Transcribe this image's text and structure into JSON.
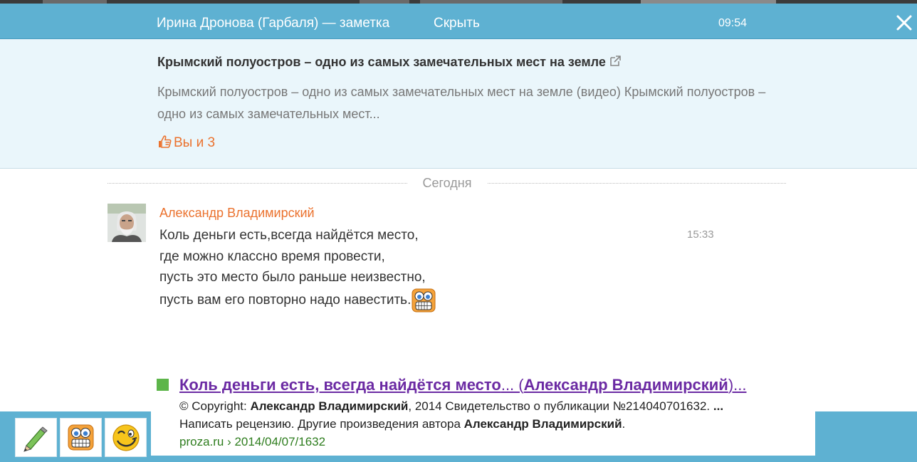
{
  "header": {
    "title": "Ирина Дронова (Гарбаля) — заметка",
    "hide_label": "Скрыть",
    "time": "09:54"
  },
  "note": {
    "title": "Крымский полуостров – одно из самых замечательных мест на земле",
    "text": "Крымский полуостров – одно из самых замечательных мест на земле (видео) Крымский полуостров – одно из самых замечательных мест...",
    "likes": "Вы и 3"
  },
  "divider": {
    "label": "Сегодня"
  },
  "message": {
    "author": "Александр Владимирский",
    "time": "15:33",
    "lines": [
      "Коль деньги есть,всегда найдётся место,",
      "где можно классно время провести,",
      "пусть это место было раньше неизвестно,",
      "пусть вам его повторно надо навестить."
    ]
  },
  "snippet": {
    "title_main": "Коль деньги есть, всегда найдётся место",
    "title_dots": "... (",
    "title_author": "Александр Владимирский",
    "title_end": ")...",
    "line1_prefix": "© Copyright: ",
    "line1_author": "Александр Владимирский",
    "line1_suffix": ", 2014 Свидетельство о публикации №214040701632. ",
    "line1_ellipsis": "...",
    "line2_prefix": "Написать рецензию. Другие произведения автора ",
    "line2_author": "Александр Владимирский",
    "line2_suffix": ".",
    "url": "proza.ru › 2014/04/07/1632"
  },
  "colors": {
    "header_bg": "#5eb1d2",
    "note_bg": "#eaf6fb",
    "accent_orange": "#eb722e",
    "link_purple": "#6b2aa3",
    "url_green": "#2e7d1e"
  },
  "icons": {
    "close": "close-icon",
    "external": "external-link-icon",
    "like": "thumbs-up-icon",
    "message_emoticon": "grinning-emoticon-icon",
    "tools": [
      "pencil-icon",
      "grinning-emoticon-icon",
      "winking-emoticon-icon"
    ]
  }
}
